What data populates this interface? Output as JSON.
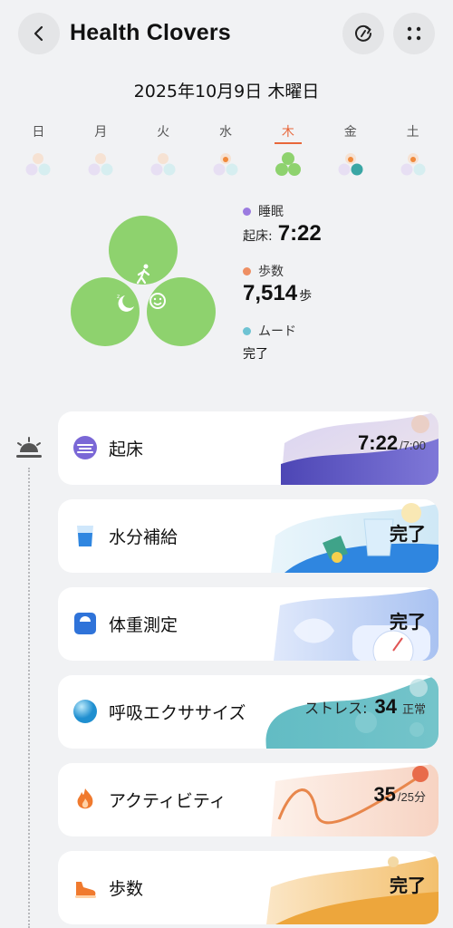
{
  "header": {
    "title": "Health Clovers",
    "back_icon": "chevron-left-icon",
    "refresh_icon": "refresh-icon",
    "more_icon": "grid-dots-icon"
  },
  "date": "2025年10月9日 木曜日",
  "week": [
    {
      "label": "日",
      "selected": false
    },
    {
      "label": "月",
      "selected": false
    },
    {
      "label": "火",
      "selected": false
    },
    {
      "label": "水",
      "selected": false
    },
    {
      "label": "木",
      "selected": true
    },
    {
      "label": "金",
      "selected": false
    },
    {
      "label": "土",
      "selected": false
    }
  ],
  "summary": {
    "sleep": {
      "label": "睡眠",
      "sub": "起床:",
      "value": "7:22",
      "color": "#9b7be0"
    },
    "steps": {
      "label": "歩数",
      "value": "7,514",
      "unit": "歩",
      "color": "#ee8f63"
    },
    "mood": {
      "label": "ムード",
      "value": "完了",
      "color": "#6ec3d3"
    }
  },
  "cards": [
    {
      "label": "起床",
      "value": "7:22",
      "sub": "/7:00",
      "icon": "wake-icon"
    },
    {
      "label": "水分補給",
      "value": "完了",
      "icon": "water-glass-icon"
    },
    {
      "label": "体重測定",
      "value": "完了",
      "icon": "scale-icon"
    },
    {
      "label": "呼吸エクササイズ",
      "prefix": "ストレス:",
      "value": "34",
      "sub": "正常",
      "icon": "breathing-icon"
    },
    {
      "label": "アクティビティ",
      "value": "35",
      "sub": "/25分",
      "icon": "flame-icon"
    },
    {
      "label": "歩数",
      "value": "完了",
      "icon": "shoe-icon"
    }
  ],
  "colors": {
    "accent": "#e8673a",
    "clover_green": "#8ed26e",
    "background": "#f1f2f4"
  }
}
